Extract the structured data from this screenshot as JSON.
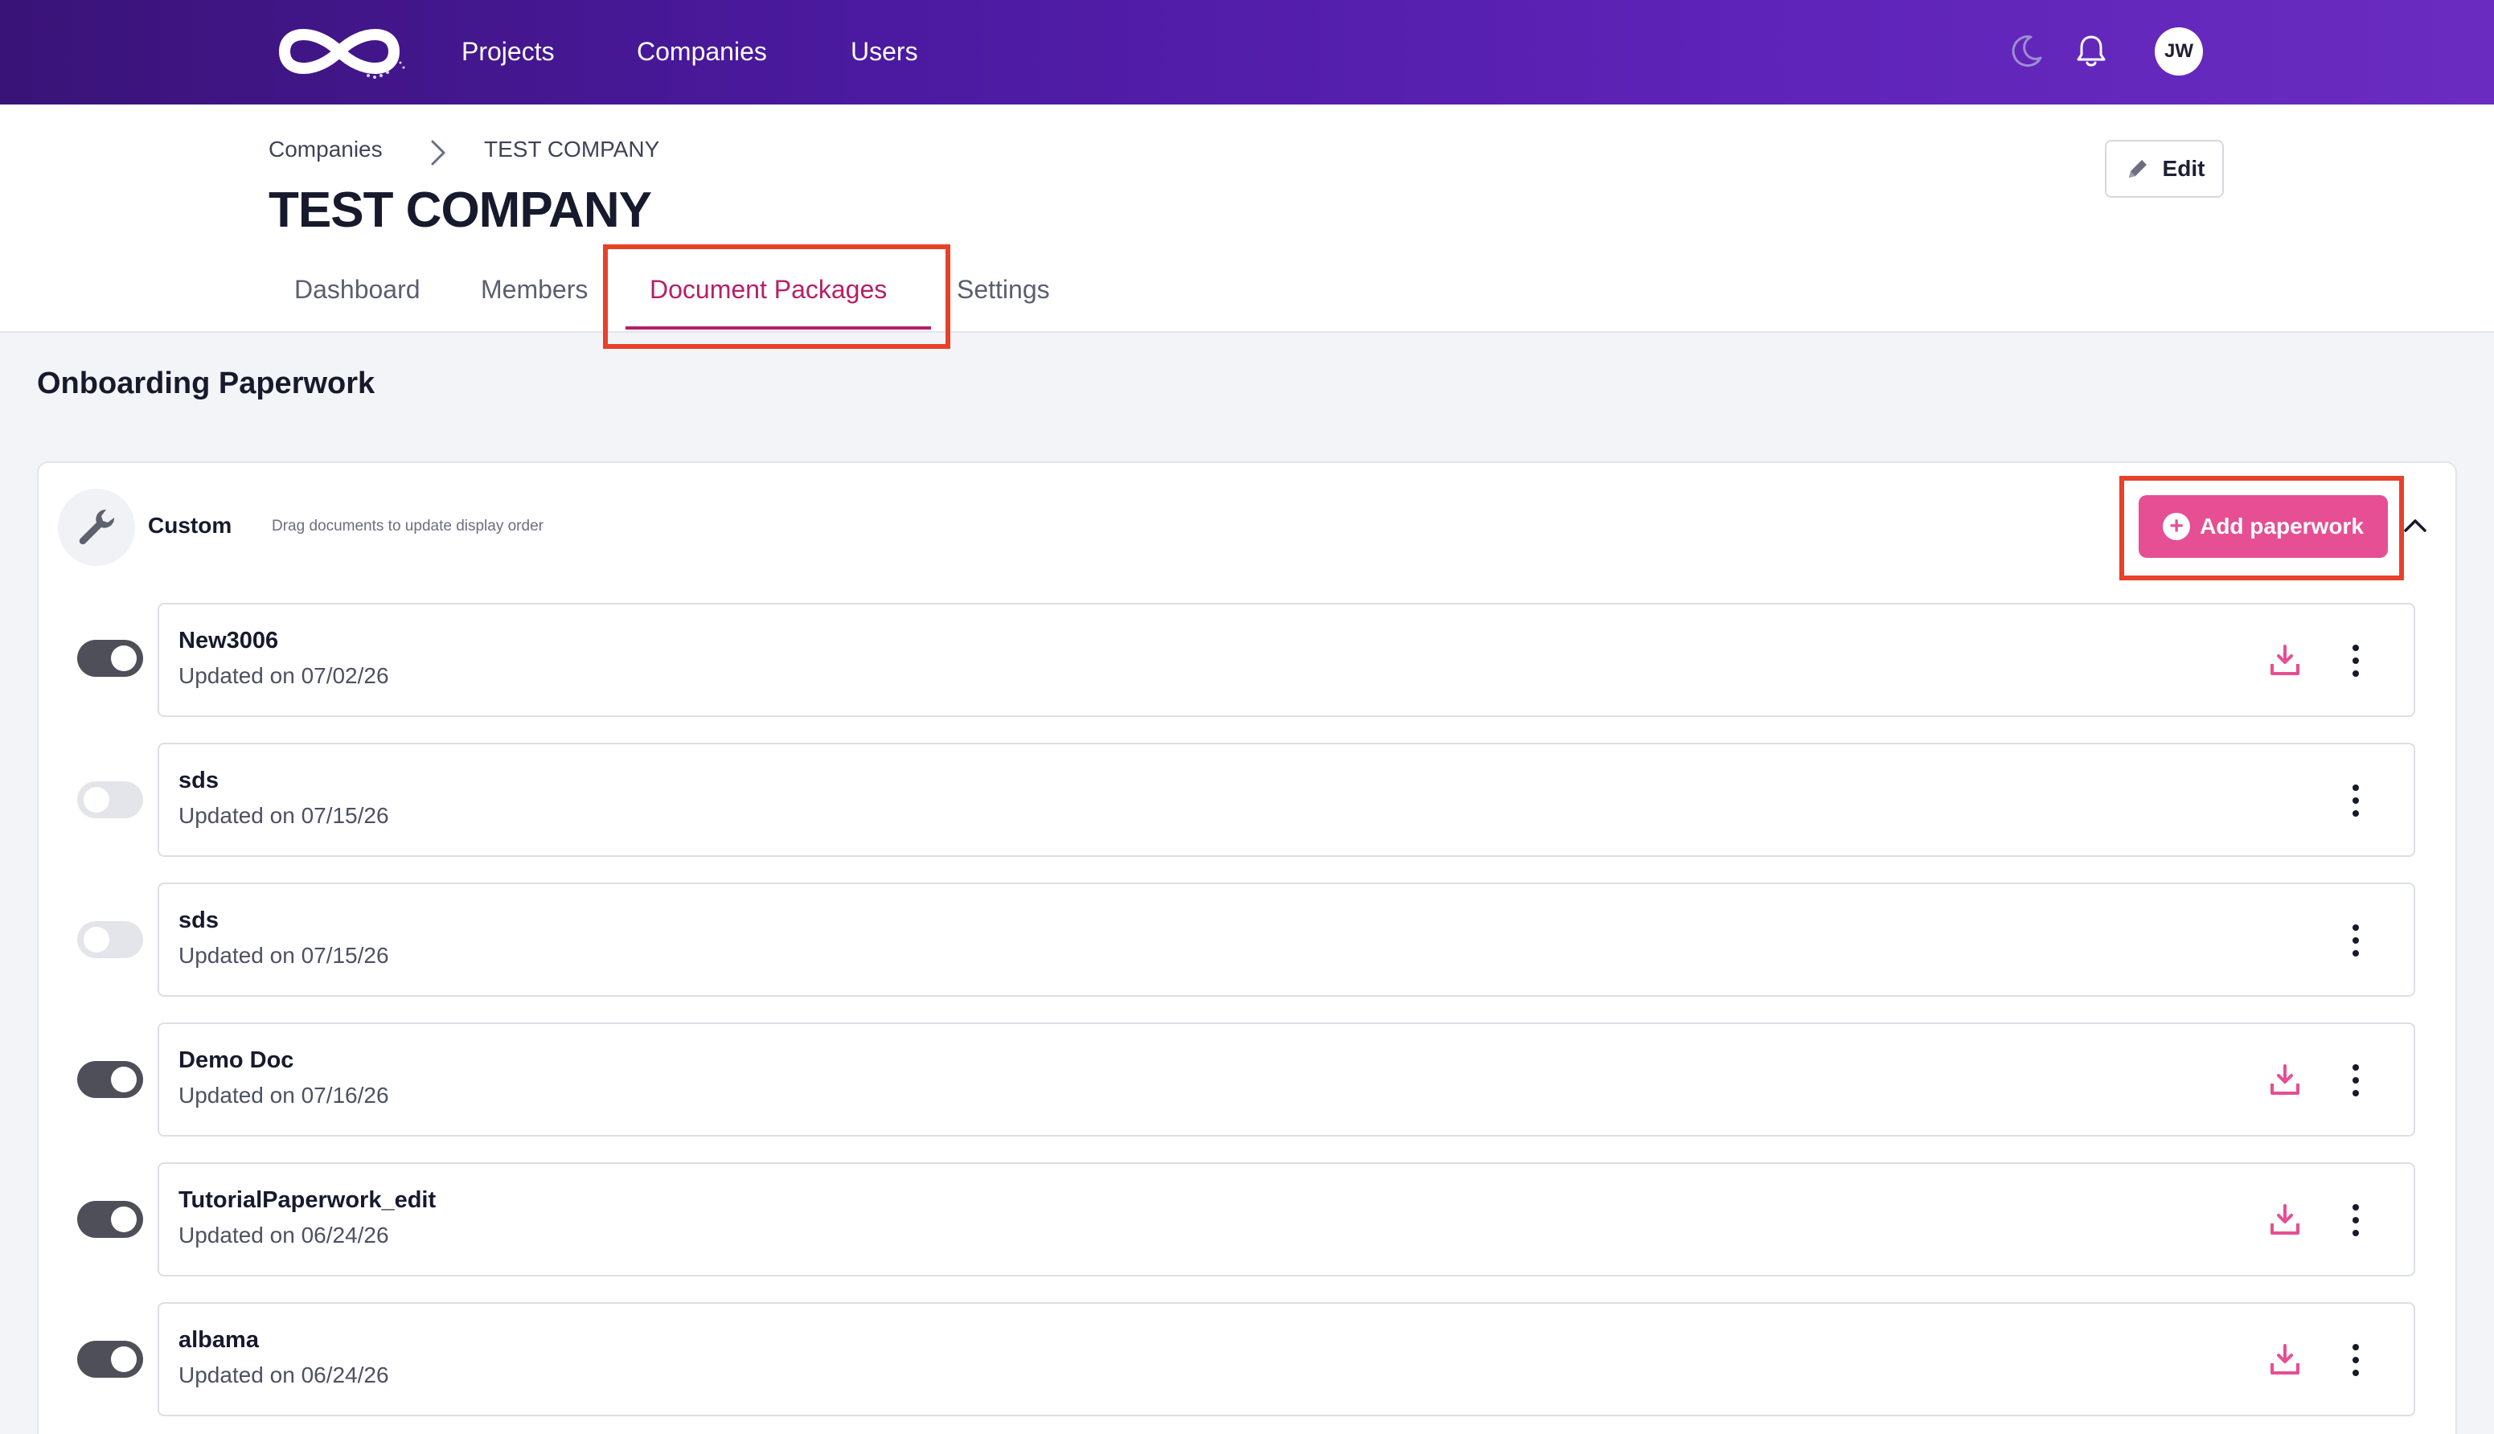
{
  "nav": {
    "links": [
      "Projects",
      "Companies",
      "Users"
    ],
    "avatar_initials": "JW",
    "icons": [
      "moon-icon",
      "bell-icon"
    ]
  },
  "header": {
    "breadcrumb": {
      "parent": "Companies",
      "current": "TEST COMPANY"
    },
    "title": "TEST COMPANY",
    "edit_label": "Edit",
    "tabs": [
      "Dashboard",
      "Members",
      "Document Packages",
      "Settings"
    ],
    "active_tab": "Document Packages"
  },
  "section": {
    "title": "Onboarding Paperwork",
    "package": {
      "name": "Custom",
      "hint": "Drag documents to update display order",
      "add_label": "Add paperwork"
    }
  },
  "documents": [
    {
      "name": "New3006",
      "updated": "Updated on 07/02/26",
      "enabled": true,
      "downloadable": true
    },
    {
      "name": "sds",
      "updated": "Updated on 07/15/26",
      "enabled": false,
      "downloadable": false
    },
    {
      "name": "sds",
      "updated": "Updated on 07/15/26",
      "enabled": false,
      "downloadable": false
    },
    {
      "name": "Demo Doc",
      "updated": "Updated on 07/16/26",
      "enabled": true,
      "downloadable": true
    },
    {
      "name": "TutorialPaperwork_edit",
      "updated": "Updated on 06/24/26",
      "enabled": true,
      "downloadable": true
    },
    {
      "name": "albama",
      "updated": "Updated on 06/24/26",
      "enabled": true,
      "downloadable": true
    }
  ],
  "colors": {
    "accent": "#e64f93",
    "active_tab": "#b52066",
    "highlight": "#e8412a",
    "nav_gradient_start": "#3a1378",
    "nav_gradient_end": "#6a2cc0",
    "toggle_on": "#4e4f58",
    "toggle_off": "#e4e5ea"
  }
}
